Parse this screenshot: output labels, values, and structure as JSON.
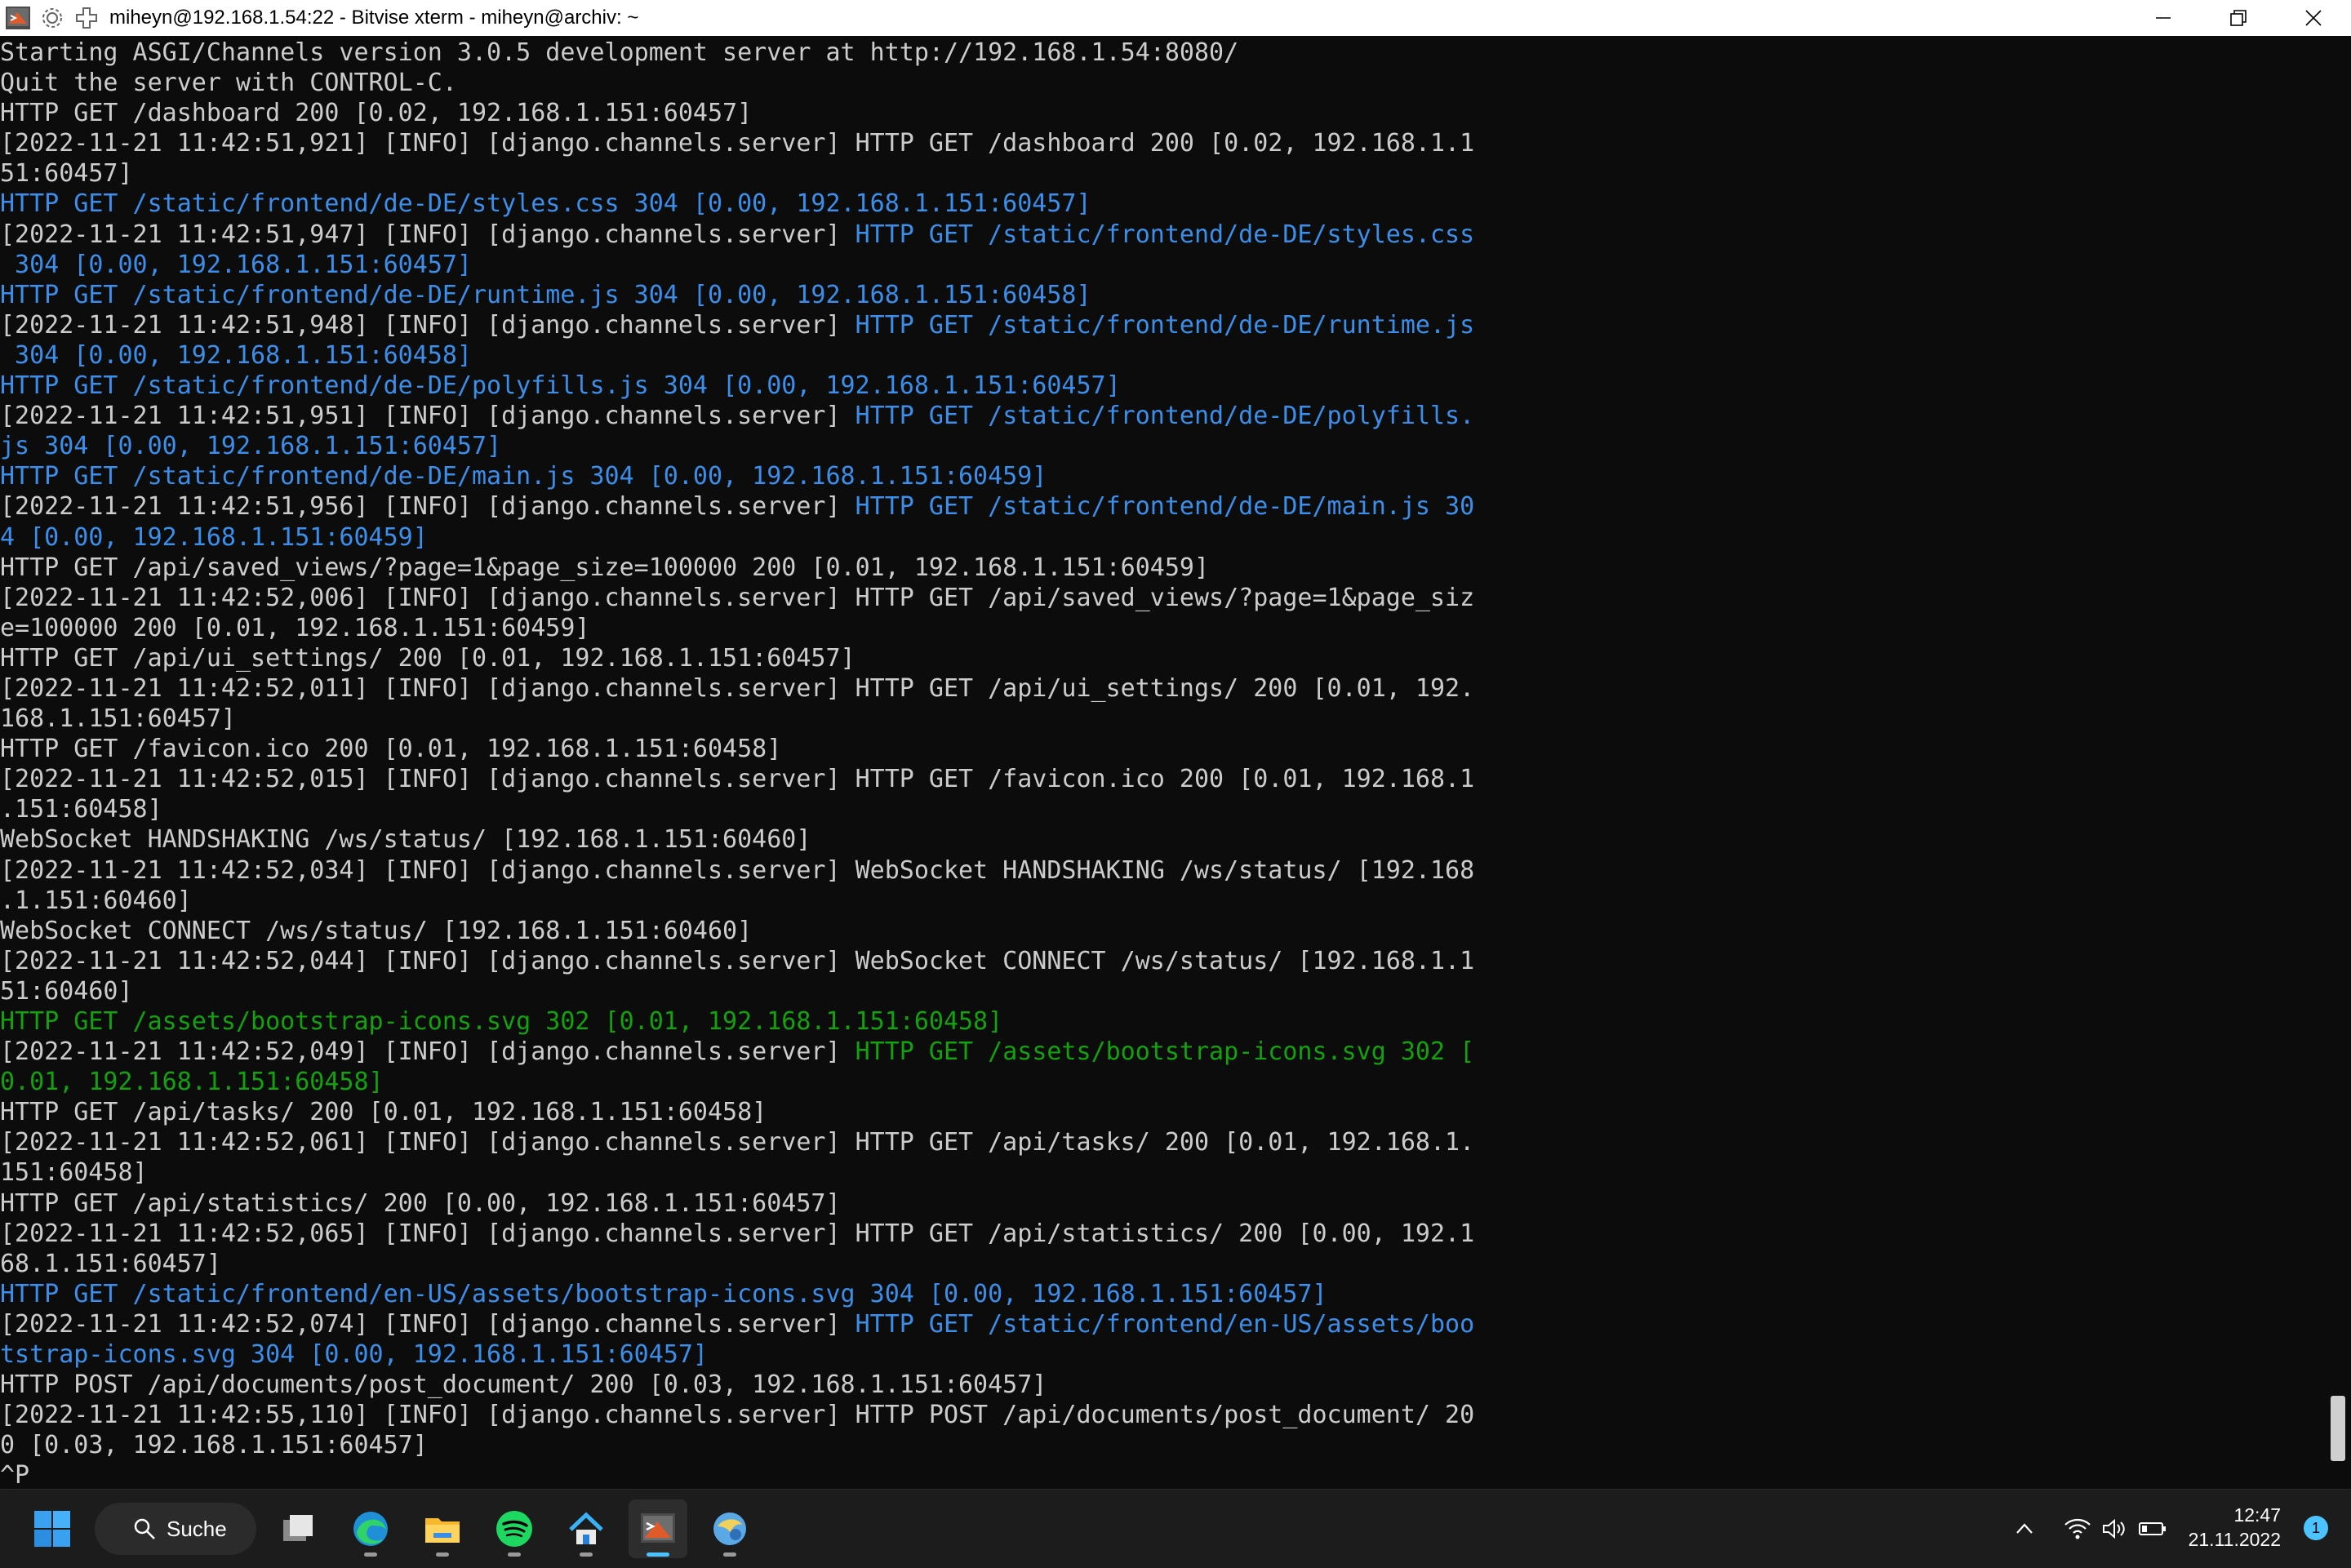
{
  "window": {
    "title": "miheyn@192.168.1.54:22 - Bitvise xterm - miheyn@archiv: ~"
  },
  "colors": {
    "default_text": "#cccccc",
    "blue_text": "#3b8eea",
    "green_text": "#13a10e",
    "terminal_bg": "#0c0c0c",
    "taskbar_bg": "#1c1c1c",
    "accent": "#4cc2ff"
  },
  "terminal": {
    "lines": [
      {
        "text": "Starting ASGI/Channels version 3.0.5 development server at http://192.168.1.54:8080/",
        "color": "default"
      },
      {
        "text": "Quit the server with CONTROL-C.",
        "color": "default"
      },
      {
        "text": "HTTP GET /dashboard 200 [0.02, 192.168.1.151:60457]",
        "color": "default"
      },
      {
        "text": "[2022-11-21 11:42:51,921] [INFO] [django.channels.server] HTTP GET /dashboard 200 [0.02, 192.168.1.1",
        "color": "default"
      },
      {
        "text": "51:60457]",
        "color": "default"
      },
      {
        "text": "HTTP GET /static/frontend/de-DE/styles.css 304 [0.00, 192.168.1.151:60457]",
        "color": "blue"
      },
      {
        "text": "[2022-11-21 11:42:51,947] [INFO] [django.channels.server] ",
        "color": "default",
        "rest": "HTTP GET /static/frontend/de-DE/styles.css",
        "rest_color": "blue"
      },
      {
        "text": " 304 [0.00, 192.168.1.151:60457]",
        "color": "blue"
      },
      {
        "text": "HTTP GET /static/frontend/de-DE/runtime.js 304 [0.00, 192.168.1.151:60458]",
        "color": "blue"
      },
      {
        "text": "[2022-11-21 11:42:51,948] [INFO] [django.channels.server] ",
        "color": "default",
        "rest": "HTTP GET /static/frontend/de-DE/runtime.js",
        "rest_color": "blue"
      },
      {
        "text": " 304 [0.00, 192.168.1.151:60458]",
        "color": "blue"
      },
      {
        "text": "HTTP GET /static/frontend/de-DE/polyfills.js 304 [0.00, 192.168.1.151:60457]",
        "color": "blue"
      },
      {
        "text": "[2022-11-21 11:42:51,951] [INFO] [django.channels.server] ",
        "color": "default",
        "rest": "HTTP GET /static/frontend/de-DE/polyfills.",
        "rest_color": "blue"
      },
      {
        "text": "js 304 [0.00, 192.168.1.151:60457]",
        "color": "blue"
      },
      {
        "text": "HTTP GET /static/frontend/de-DE/main.js 304 [0.00, 192.168.1.151:60459]",
        "color": "blue"
      },
      {
        "text": "[2022-11-21 11:42:51,956] [INFO] [django.channels.server] ",
        "color": "default",
        "rest": "HTTP GET /static/frontend/de-DE/main.js 30",
        "rest_color": "blue"
      },
      {
        "text": "4 [0.00, 192.168.1.151:60459]",
        "color": "blue"
      },
      {
        "text": "HTTP GET /api/saved_views/?page=1&page_size=100000 200 [0.01, 192.168.1.151:60459]",
        "color": "default"
      },
      {
        "text": "[2022-11-21 11:42:52,006] [INFO] [django.channels.server] HTTP GET /api/saved_views/?page=1&page_siz",
        "color": "default"
      },
      {
        "text": "e=100000 200 [0.01, 192.168.1.151:60459]",
        "color": "default"
      },
      {
        "text": "HTTP GET /api/ui_settings/ 200 [0.01, 192.168.1.151:60457]",
        "color": "default"
      },
      {
        "text": "[2022-11-21 11:42:52,011] [INFO] [django.channels.server] HTTP GET /api/ui_settings/ 200 [0.01, 192.",
        "color": "default"
      },
      {
        "text": "168.1.151:60457]",
        "color": "default"
      },
      {
        "text": "HTTP GET /favicon.ico 200 [0.01, 192.168.1.151:60458]",
        "color": "default"
      },
      {
        "text": "[2022-11-21 11:42:52,015] [INFO] [django.channels.server] HTTP GET /favicon.ico 200 [0.01, 192.168.1",
        "color": "default"
      },
      {
        "text": ".151:60458]",
        "color": "default"
      },
      {
        "text": "WebSocket HANDSHAKING /ws/status/ [192.168.1.151:60460]",
        "color": "default"
      },
      {
        "text": "[2022-11-21 11:42:52,034] [INFO] [django.channels.server] WebSocket HANDSHAKING /ws/status/ [192.168",
        "color": "default"
      },
      {
        "text": ".1.151:60460]",
        "color": "default"
      },
      {
        "text": "WebSocket CONNECT /ws/status/ [192.168.1.151:60460]",
        "color": "default"
      },
      {
        "text": "[2022-11-21 11:42:52,044] [INFO] [django.channels.server] WebSocket CONNECT /ws/status/ [192.168.1.1",
        "color": "default"
      },
      {
        "text": "51:60460]",
        "color": "default"
      },
      {
        "text": "HTTP GET /assets/bootstrap-icons.svg 302 [0.01, 192.168.1.151:60458]",
        "color": "green"
      },
      {
        "text": "[2022-11-21 11:42:52,049] [INFO] [django.channels.server] ",
        "color": "default",
        "rest": "HTTP GET /assets/bootstrap-icons.svg 302 [",
        "rest_color": "green"
      },
      {
        "text": "0.01, 192.168.1.151:60458]",
        "color": "green"
      },
      {
        "text": "HTTP GET /api/tasks/ 200 [0.01, 192.168.1.151:60458]",
        "color": "default"
      },
      {
        "text": "[2022-11-21 11:42:52,061] [INFO] [django.channels.server] HTTP GET /api/tasks/ 200 [0.01, 192.168.1.",
        "color": "default"
      },
      {
        "text": "151:60458]",
        "color": "default"
      },
      {
        "text": "HTTP GET /api/statistics/ 200 [0.00, 192.168.1.151:60457]",
        "color": "default"
      },
      {
        "text": "[2022-11-21 11:42:52,065] [INFO] [django.channels.server] HTTP GET /api/statistics/ 200 [0.00, 192.1",
        "color": "default"
      },
      {
        "text": "68.1.151:60457]",
        "color": "default"
      },
      {
        "text": "HTTP GET /static/frontend/en-US/assets/bootstrap-icons.svg 304 [0.00, 192.168.1.151:60457]",
        "color": "blue"
      },
      {
        "text": "[2022-11-21 11:42:52,074] [INFO] [django.channels.server] ",
        "color": "default",
        "rest": "HTTP GET /static/frontend/en-US/assets/boo",
        "rest_color": "blue"
      },
      {
        "text": "tstrap-icons.svg 304 [0.00, 192.168.1.151:60457]",
        "color": "blue"
      },
      {
        "text": "HTTP POST /api/documents/post_document/ 200 [0.03, 192.168.1.151:60457]",
        "color": "default"
      },
      {
        "text": "[2022-11-21 11:42:55,110] [INFO] [django.channels.server] HTTP POST /api/documents/post_document/ 20",
        "color": "default"
      },
      {
        "text": "0 [0.03, 192.168.1.151:60457]",
        "color": "default"
      },
      {
        "text": "^P",
        "color": "default"
      }
    ]
  },
  "taskbar": {
    "search_label": "Suche",
    "clock_time": "12:47",
    "clock_date": "21.11.2022",
    "notification_count": "1",
    "apps": [
      "task-view",
      "edge",
      "file-explorer",
      "spotify",
      "network-drive",
      "bitvise-xterm",
      "bitvise-client"
    ],
    "active_app": "bitvise-xterm"
  }
}
